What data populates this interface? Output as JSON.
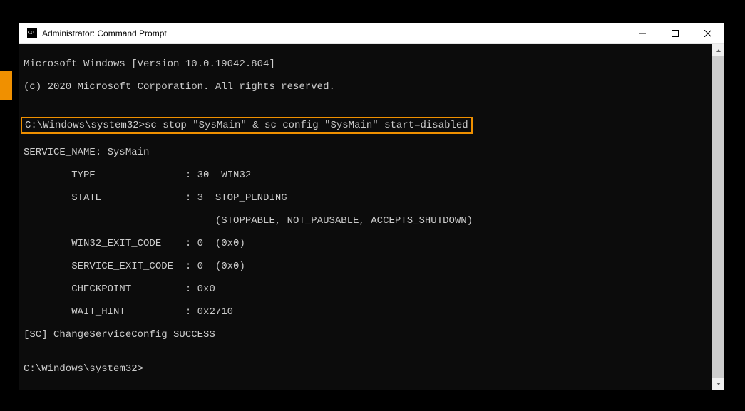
{
  "accent": {
    "color": "#f09000"
  },
  "titlebar": {
    "title": "Administrator: Command Prompt"
  },
  "console": {
    "lines": {
      "l0": "Microsoft Windows [Version 10.0.19042.804]",
      "l1": "(c) 2020 Microsoft Corporation. All rights reserved.",
      "l2": "",
      "highlighted": "C:\\Windows\\system32>sc stop \"SysMain\" & sc config \"SysMain\" start=disabled",
      "l4": "",
      "l5": "SERVICE_NAME: SysMain",
      "l6": "        TYPE               : 30  WIN32",
      "l7": "        STATE              : 3  STOP_PENDING",
      "l8": "                                (STOPPABLE, NOT_PAUSABLE, ACCEPTS_SHUTDOWN)",
      "l9": "        WIN32_EXIT_CODE    : 0  (0x0)",
      "l10": "        SERVICE_EXIT_CODE  : 0  (0x0)",
      "l11": "        CHECKPOINT         : 0x0",
      "l12": "        WAIT_HINT          : 0x2710",
      "l13": "[SC] ChangeServiceConfig SUCCESS",
      "l14": "",
      "l15": "C:\\Windows\\system32>"
    }
  }
}
